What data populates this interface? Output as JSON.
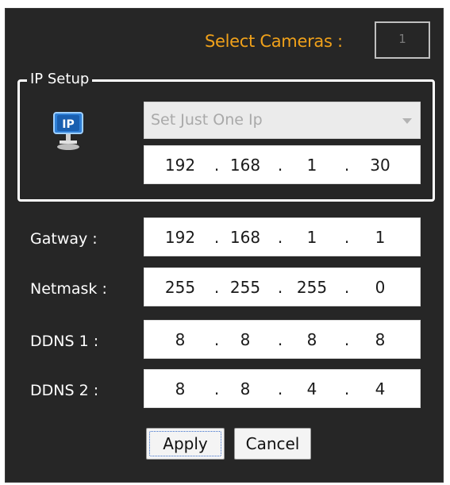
{
  "header": {
    "select_cameras_label": "Select Cameras :",
    "camera_count": "1"
  },
  "ip_setup": {
    "title": "IP Setup",
    "icon": "network-ip-icon",
    "mode_select": {
      "value": "Set Just One Ip"
    },
    "ip": [
      "192",
      "168",
      "1",
      "30"
    ]
  },
  "fields": {
    "gateway": {
      "label": "Gatway :",
      "octets": [
        "192",
        "168",
        "1",
        "1"
      ]
    },
    "netmask": {
      "label": "Netmask :",
      "octets": [
        "255",
        "255",
        "255",
        "0"
      ]
    },
    "ddns1": {
      "label": "DDNS 1 :",
      "octets": [
        "8",
        "8",
        "8",
        "8"
      ]
    },
    "ddns2": {
      "label": "DDNS 2 :",
      "octets": [
        "8",
        "8",
        "4",
        "4"
      ]
    }
  },
  "buttons": {
    "apply": "Apply",
    "cancel": "Cancel"
  },
  "colors": {
    "panel_bg": "#262626",
    "accent": "#f0a11a",
    "text": "#ffffff"
  }
}
